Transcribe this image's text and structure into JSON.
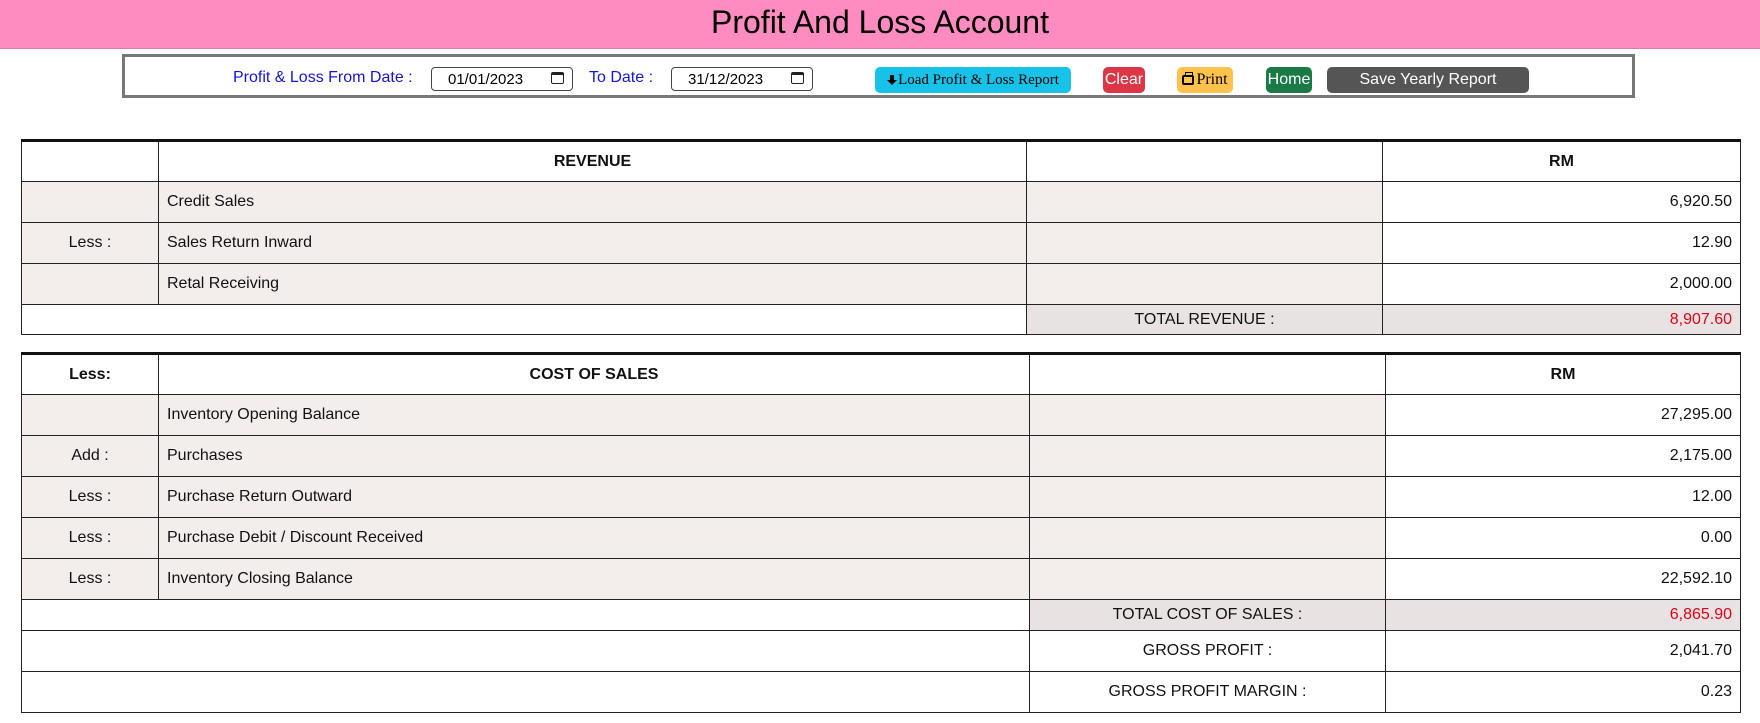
{
  "page": {
    "title": "Profit And Loss Account"
  },
  "filters": {
    "from_label": "Profit & Loss From Date :",
    "from_value": "01/01/2023",
    "to_label": "To Date :",
    "to_value": "31/12/2023"
  },
  "buttons": {
    "load": "Load Profit & Loss Report",
    "clear": "Clear",
    "print": "Print",
    "home": "Home",
    "save": "Save Yearly Report"
  },
  "revenue": {
    "header": "REVENUE",
    "currency": "RM",
    "rows": [
      {
        "side": "",
        "label": "Credit Sales",
        "value": "6,920.50"
      },
      {
        "side": "Less :",
        "label": "Sales Return Inward",
        "value": "12.90"
      },
      {
        "side": "",
        "label": "Retal Receiving",
        "value": "2,000.00"
      }
    ],
    "total_label": "TOTAL REVENUE :",
    "total_value": "8,907.60"
  },
  "cost_of_sales": {
    "side_header": "Less:",
    "header": "COST OF SALES",
    "currency": "RM",
    "rows": [
      {
        "side": "",
        "label": "Inventory Opening Balance",
        "value": "27,295.00"
      },
      {
        "side": "Add :",
        "label": "Purchases",
        "value": "2,175.00"
      },
      {
        "side": "Less :",
        "label": "Purchase Return Outward",
        "value": "12.00"
      },
      {
        "side": "Less :",
        "label": "Purchase Debit / Discount Received",
        "value": "0.00"
      },
      {
        "side": "Less :",
        "label": "Inventory Closing Balance",
        "value": "22,592.10"
      }
    ],
    "total_label": "TOTAL COST OF SALES :",
    "total_value": "6,865.90",
    "gross_profit_label": "GROSS PROFIT :",
    "gross_profit_value": "2,041.70",
    "gross_margin_label": "GROSS PROFIT MARGIN :",
    "gross_margin_value": "0.23"
  },
  "colors": {
    "title_bar": "#ff8cc0",
    "label_blue": "#1515d6",
    "total_red": "#e0001a",
    "load_btn": "#17c2e8",
    "clear_btn": "#dc3545",
    "print_btn": "#ffc34d",
    "home_btn": "#1a7a45",
    "save_btn": "#555555"
  }
}
